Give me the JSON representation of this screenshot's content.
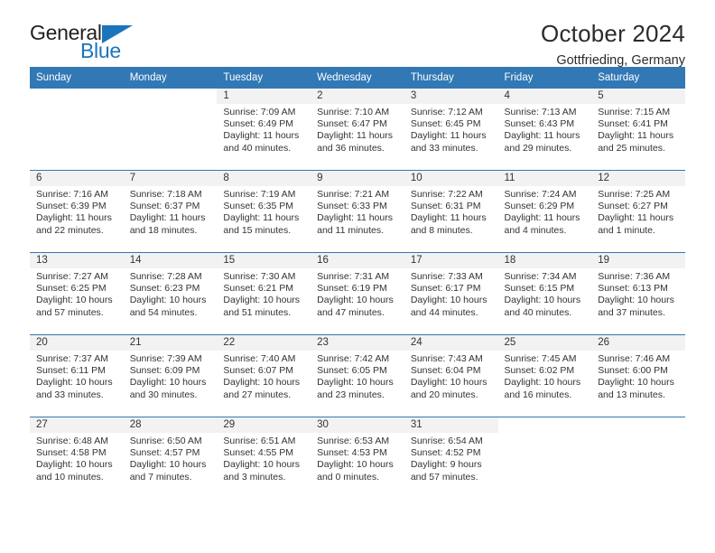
{
  "brand": {
    "name_part1": "General",
    "name_part2": "Blue",
    "triangle_icon": "triangle-icon",
    "accent_color": "#1b75bb"
  },
  "header": {
    "title": "October 2024",
    "subtitle": "Gottfrieding, Germany"
  },
  "calendar": {
    "header_color": "#3178b5",
    "daynum_band_color": "#f2f2f2",
    "weekdays": [
      "Sunday",
      "Monday",
      "Tuesday",
      "Wednesday",
      "Thursday",
      "Friday",
      "Saturday"
    ],
    "weeks": [
      [
        {
          "day": "",
          "sunrise": "",
          "sunset": "",
          "daylight1": "",
          "daylight2": ""
        },
        {
          "day": "",
          "sunrise": "",
          "sunset": "",
          "daylight1": "",
          "daylight2": ""
        },
        {
          "day": "1",
          "sunrise": "Sunrise: 7:09 AM",
          "sunset": "Sunset: 6:49 PM",
          "daylight1": "Daylight: 11 hours",
          "daylight2": "and 40 minutes."
        },
        {
          "day": "2",
          "sunrise": "Sunrise: 7:10 AM",
          "sunset": "Sunset: 6:47 PM",
          "daylight1": "Daylight: 11 hours",
          "daylight2": "and 36 minutes."
        },
        {
          "day": "3",
          "sunrise": "Sunrise: 7:12 AM",
          "sunset": "Sunset: 6:45 PM",
          "daylight1": "Daylight: 11 hours",
          "daylight2": "and 33 minutes."
        },
        {
          "day": "4",
          "sunrise": "Sunrise: 7:13 AM",
          "sunset": "Sunset: 6:43 PM",
          "daylight1": "Daylight: 11 hours",
          "daylight2": "and 29 minutes."
        },
        {
          "day": "5",
          "sunrise": "Sunrise: 7:15 AM",
          "sunset": "Sunset: 6:41 PM",
          "daylight1": "Daylight: 11 hours",
          "daylight2": "and 25 minutes."
        }
      ],
      [
        {
          "day": "6",
          "sunrise": "Sunrise: 7:16 AM",
          "sunset": "Sunset: 6:39 PM",
          "daylight1": "Daylight: 11 hours",
          "daylight2": "and 22 minutes."
        },
        {
          "day": "7",
          "sunrise": "Sunrise: 7:18 AM",
          "sunset": "Sunset: 6:37 PM",
          "daylight1": "Daylight: 11 hours",
          "daylight2": "and 18 minutes."
        },
        {
          "day": "8",
          "sunrise": "Sunrise: 7:19 AM",
          "sunset": "Sunset: 6:35 PM",
          "daylight1": "Daylight: 11 hours",
          "daylight2": "and 15 minutes."
        },
        {
          "day": "9",
          "sunrise": "Sunrise: 7:21 AM",
          "sunset": "Sunset: 6:33 PM",
          "daylight1": "Daylight: 11 hours",
          "daylight2": "and 11 minutes."
        },
        {
          "day": "10",
          "sunrise": "Sunrise: 7:22 AM",
          "sunset": "Sunset: 6:31 PM",
          "daylight1": "Daylight: 11 hours",
          "daylight2": "and 8 minutes."
        },
        {
          "day": "11",
          "sunrise": "Sunrise: 7:24 AM",
          "sunset": "Sunset: 6:29 PM",
          "daylight1": "Daylight: 11 hours",
          "daylight2": "and 4 minutes."
        },
        {
          "day": "12",
          "sunrise": "Sunrise: 7:25 AM",
          "sunset": "Sunset: 6:27 PM",
          "daylight1": "Daylight: 11 hours",
          "daylight2": "and 1 minute."
        }
      ],
      [
        {
          "day": "13",
          "sunrise": "Sunrise: 7:27 AM",
          "sunset": "Sunset: 6:25 PM",
          "daylight1": "Daylight: 10 hours",
          "daylight2": "and 57 minutes."
        },
        {
          "day": "14",
          "sunrise": "Sunrise: 7:28 AM",
          "sunset": "Sunset: 6:23 PM",
          "daylight1": "Daylight: 10 hours",
          "daylight2": "and 54 minutes."
        },
        {
          "day": "15",
          "sunrise": "Sunrise: 7:30 AM",
          "sunset": "Sunset: 6:21 PM",
          "daylight1": "Daylight: 10 hours",
          "daylight2": "and 51 minutes."
        },
        {
          "day": "16",
          "sunrise": "Sunrise: 7:31 AM",
          "sunset": "Sunset: 6:19 PM",
          "daylight1": "Daylight: 10 hours",
          "daylight2": "and 47 minutes."
        },
        {
          "day": "17",
          "sunrise": "Sunrise: 7:33 AM",
          "sunset": "Sunset: 6:17 PM",
          "daylight1": "Daylight: 10 hours",
          "daylight2": "and 44 minutes."
        },
        {
          "day": "18",
          "sunrise": "Sunrise: 7:34 AM",
          "sunset": "Sunset: 6:15 PM",
          "daylight1": "Daylight: 10 hours",
          "daylight2": "and 40 minutes."
        },
        {
          "day": "19",
          "sunrise": "Sunrise: 7:36 AM",
          "sunset": "Sunset: 6:13 PM",
          "daylight1": "Daylight: 10 hours",
          "daylight2": "and 37 minutes."
        }
      ],
      [
        {
          "day": "20",
          "sunrise": "Sunrise: 7:37 AM",
          "sunset": "Sunset: 6:11 PM",
          "daylight1": "Daylight: 10 hours",
          "daylight2": "and 33 minutes."
        },
        {
          "day": "21",
          "sunrise": "Sunrise: 7:39 AM",
          "sunset": "Sunset: 6:09 PM",
          "daylight1": "Daylight: 10 hours",
          "daylight2": "and 30 minutes."
        },
        {
          "day": "22",
          "sunrise": "Sunrise: 7:40 AM",
          "sunset": "Sunset: 6:07 PM",
          "daylight1": "Daylight: 10 hours",
          "daylight2": "and 27 minutes."
        },
        {
          "day": "23",
          "sunrise": "Sunrise: 7:42 AM",
          "sunset": "Sunset: 6:05 PM",
          "daylight1": "Daylight: 10 hours",
          "daylight2": "and 23 minutes."
        },
        {
          "day": "24",
          "sunrise": "Sunrise: 7:43 AM",
          "sunset": "Sunset: 6:04 PM",
          "daylight1": "Daylight: 10 hours",
          "daylight2": "and 20 minutes."
        },
        {
          "day": "25",
          "sunrise": "Sunrise: 7:45 AM",
          "sunset": "Sunset: 6:02 PM",
          "daylight1": "Daylight: 10 hours",
          "daylight2": "and 16 minutes."
        },
        {
          "day": "26",
          "sunrise": "Sunrise: 7:46 AM",
          "sunset": "Sunset: 6:00 PM",
          "daylight1": "Daylight: 10 hours",
          "daylight2": "and 13 minutes."
        }
      ],
      [
        {
          "day": "27",
          "sunrise": "Sunrise: 6:48 AM",
          "sunset": "Sunset: 4:58 PM",
          "daylight1": "Daylight: 10 hours",
          "daylight2": "and 10 minutes."
        },
        {
          "day": "28",
          "sunrise": "Sunrise: 6:50 AM",
          "sunset": "Sunset: 4:57 PM",
          "daylight1": "Daylight: 10 hours",
          "daylight2": "and 7 minutes."
        },
        {
          "day": "29",
          "sunrise": "Sunrise: 6:51 AM",
          "sunset": "Sunset: 4:55 PM",
          "daylight1": "Daylight: 10 hours",
          "daylight2": "and 3 minutes."
        },
        {
          "day": "30",
          "sunrise": "Sunrise: 6:53 AM",
          "sunset": "Sunset: 4:53 PM",
          "daylight1": "Daylight: 10 hours",
          "daylight2": "and 0 minutes."
        },
        {
          "day": "31",
          "sunrise": "Sunrise: 6:54 AM",
          "sunset": "Sunset: 4:52 PM",
          "daylight1": "Daylight: 9 hours",
          "daylight2": "and 57 minutes."
        },
        {
          "day": "",
          "sunrise": "",
          "sunset": "",
          "daylight1": "",
          "daylight2": ""
        },
        {
          "day": "",
          "sunrise": "",
          "sunset": "",
          "daylight1": "",
          "daylight2": ""
        }
      ]
    ]
  }
}
